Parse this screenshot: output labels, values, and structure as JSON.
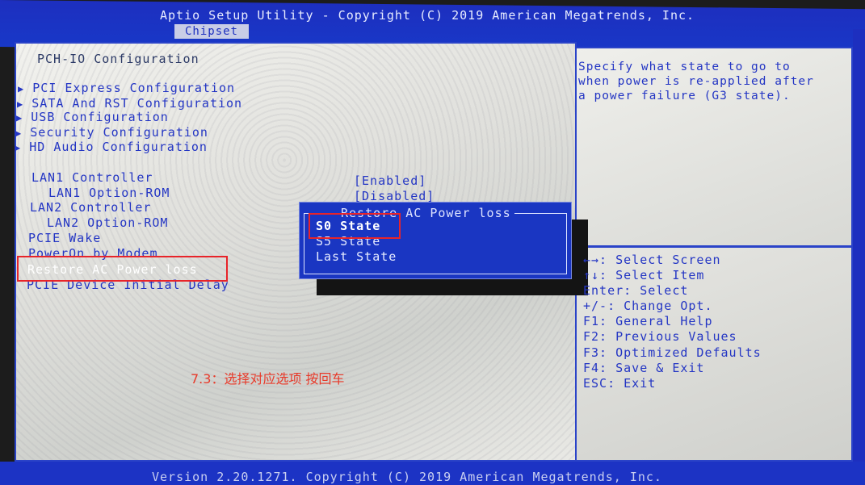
{
  "header": {
    "title": "Aptio Setup Utility - Copyright (C) 2019 American Megatrends, Inc.",
    "active_tab": "Chipset"
  },
  "main": {
    "section_title": "PCH-IO Configuration",
    "submenus": [
      {
        "label": "PCI Express Configuration"
      },
      {
        "label": "SATA And RST Configuration"
      },
      {
        "label": "USB Configuration"
      },
      {
        "label": "Security Configuration"
      },
      {
        "label": "HD Audio Configuration"
      }
    ],
    "settings": [
      {
        "label": "LAN1 Controller",
        "value": "[Enabled]"
      },
      {
        "label": "LAN1 Option-ROM",
        "value": "[Disabled]"
      },
      {
        "label": "LAN2 Controller"
      },
      {
        "label": "LAN2 Option-ROM"
      },
      {
        "label": "PCIE Wake"
      },
      {
        "label": "PowerOn by Modem"
      },
      {
        "label": "Restore AC Power loss"
      },
      {
        "label": "PCIE Device Initial Delay"
      }
    ]
  },
  "popup": {
    "title": "Restore AC Power loss",
    "options": [
      "S0 State",
      "S5 State",
      "Last State"
    ],
    "selected": "S0 State"
  },
  "help": {
    "lines": [
      "Specify what state to go to",
      "when power is re-applied after",
      "a power failure (G3 state)."
    ]
  },
  "keys": [
    "←→: Select Screen",
    "↑↓: Select Item",
    "Enter: Select",
    "+/-: Change Opt.",
    "F1: General Help",
    "F2: Previous Values",
    "F3: Optimized Defaults",
    "F4: Save & Exit",
    "ESC: Exit"
  ],
  "footer": "Version 2.20.1271. Copyright (C) 2019 American Megatrends, Inc.",
  "annotation": "7.3：选择对应选项 按回车",
  "colors": {
    "bios_blue": "#1d2fbf",
    "text_blue": "#2436c4",
    "highlight_red": "#e8242a"
  },
  "icons": {
    "submenu_marker": "triangle-right-icon"
  }
}
